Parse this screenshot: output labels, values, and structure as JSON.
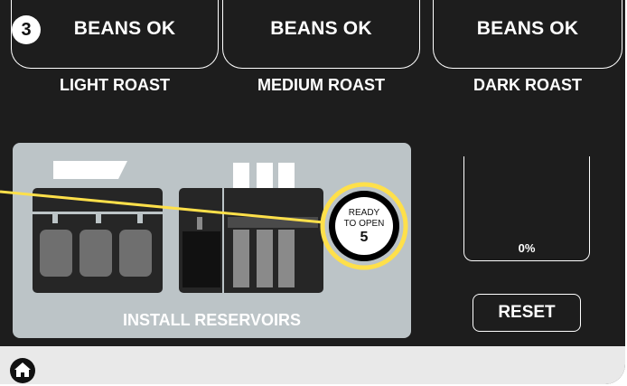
{
  "step": {
    "number": "3"
  },
  "hoppers": [
    {
      "status": "BEANS OK",
      "label": "LIGHT ROAST"
    },
    {
      "status": "BEANS OK",
      "label": "MEDIUM ROAST"
    },
    {
      "status": "BEANS OK",
      "label": "DARK ROAST"
    }
  ],
  "install": {
    "label": "INSTALL RESERVOIRS",
    "countdown": {
      "line1": "READY",
      "line2": "TO OPEN",
      "seconds": "5"
    }
  },
  "gauge": {
    "value": "0%",
    "fill_fraction": 0
  },
  "reset": {
    "label": "RESET"
  },
  "footer": {
    "home_icon": "home-icon"
  },
  "colors": {
    "screen_background": "#1d1d1d",
    "panel": "#bcc4c7",
    "highlight_ring": "#ffe04a",
    "footer": "#e9e9e9"
  }
}
